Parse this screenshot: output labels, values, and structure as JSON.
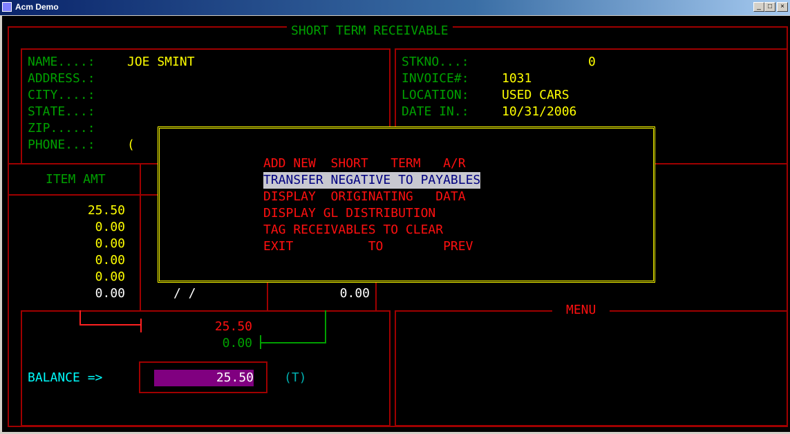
{
  "window": {
    "title": "Acm Demo",
    "min_label": "_",
    "max_label": "□",
    "close_label": "×"
  },
  "screen_title": "SHORT TERM RECEIVABLE",
  "customer": {
    "name_label": "NAME....:",
    "name": "JOE SMINT",
    "address_label": "ADDRESS.:",
    "city_label": "CITY....:",
    "state_label": "STATE...:",
    "zip_label": "ZIP.....:",
    "phone_label": "PHONE...:",
    "phone": "("
  },
  "stock": {
    "stkno_label": "STKNO...:",
    "stkno": "0",
    "invoice_label": "INVOICE#:",
    "invoice": "1031",
    "location_label": "LOCATION:",
    "location": "USED CARS",
    "date_label": "DATE IN.:",
    "date": "10/31/2006"
  },
  "items": {
    "header": "ITEM AMT",
    "amounts": [
      "25.50",
      "0.00",
      "0.00",
      "0.00",
      "0.00",
      "0.00"
    ],
    "date_value": "/ /",
    "total_value": "0.00"
  },
  "totals": {
    "charges": "25.50",
    "payments": "0.00"
  },
  "balance": {
    "label": "BALANCE =>",
    "value": "25.50",
    "flag": "(T)"
  },
  "menu_title": "MENU",
  "popup": {
    "items": [
      "ADD NEW  SHORT   TERM   A/R",
      "TRANSFER NEGATIVE TO PAYABLES",
      "DISPLAY  ORIGINATING   DATA",
      "DISPLAY GL DISTRIBUTION",
      "TAG RECEIVABLES TO CLEAR",
      "EXIT          TO        PREV"
    ],
    "selected_index": 1
  }
}
